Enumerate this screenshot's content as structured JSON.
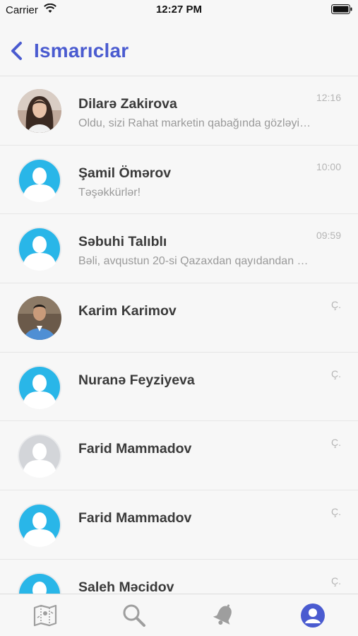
{
  "status_bar": {
    "carrier": "Carrier",
    "time": "12:27 PM"
  },
  "nav": {
    "back_icon": "chevron-left-icon",
    "title": "Ismarıclar"
  },
  "conversations": [
    {
      "name": "Dilarə Zakirova",
      "preview": "Oldu, sizi Rahat marketin qabağında gözləyirəm",
      "time": "12:16",
      "avatar": "photo-woman"
    },
    {
      "name": "Şamil Ömərov",
      "preview": "Təşəkkürlər!",
      "time": "10:00",
      "avatar": "default-blue"
    },
    {
      "name": "Səbuhi Talıblı",
      "preview": "Bəli, avqustun 20-si Qazaxdan qayıdandan sonra",
      "time": "09:59",
      "avatar": "default-blue"
    },
    {
      "name": "Karim Karimov",
      "preview": "",
      "time": "Ç.",
      "avatar": "photo-man"
    },
    {
      "name": "Nuranə Feyziyeva",
      "preview": "",
      "time": "Ç.",
      "avatar": "default-blue"
    },
    {
      "name": "Farid Mammadov",
      "preview": "",
      "time": "Ç.",
      "avatar": "default-grey"
    },
    {
      "name": "Farid Mammadov",
      "preview": "",
      "time": "Ç.",
      "avatar": "default-blue"
    },
    {
      "name": "Saleh Məcidov",
      "preview": "",
      "time": "Ç.",
      "avatar": "default-blue"
    }
  ],
  "tab_bar": {
    "tabs": [
      {
        "icon": "map-icon",
        "active": false
      },
      {
        "icon": "search-icon",
        "active": false
      },
      {
        "icon": "bell-icon",
        "active": false
      },
      {
        "icon": "profile-icon",
        "active": true
      }
    ]
  },
  "colors": {
    "accent": "#4a5bd0",
    "avatar_blue": "#29b6e8",
    "avatar_grey": "#d3d5d9",
    "tab_inactive": "#9e9e9e"
  }
}
